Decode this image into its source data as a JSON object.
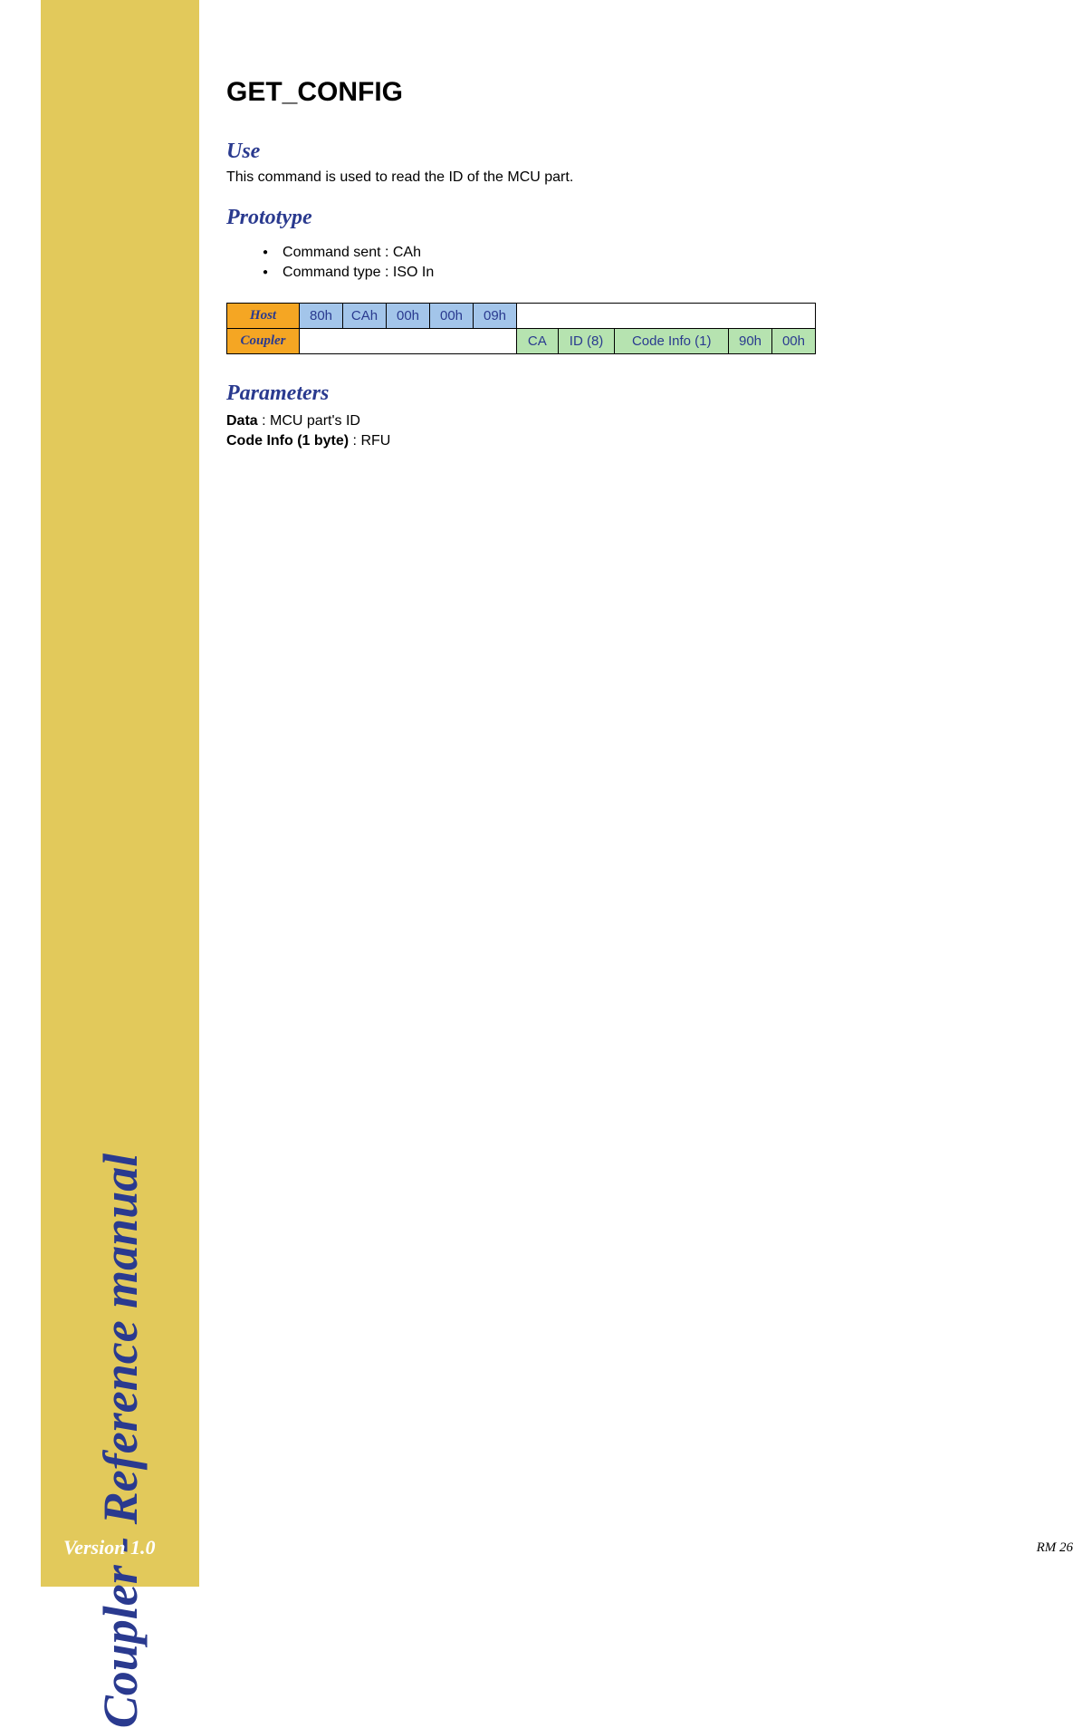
{
  "sidebar": {
    "title": "Coupler - Reference manual",
    "version": "Version 1.0"
  },
  "page": {
    "title": "GET_CONFIG",
    "footer": "RM 26"
  },
  "sections": {
    "use": {
      "heading": "Use",
      "text": "This command is used to read the ID of the MCU part."
    },
    "prototype": {
      "heading": "Prototype",
      "bullets": [
        "Command sent : CAh",
        "Command type : ISO In"
      ]
    },
    "parameters": {
      "heading": "Parameters",
      "data_label": "Data",
      "data_value": " : MCU part's ID",
      "code_label": "Code Info (1 byte)",
      "code_value": " : RFU"
    }
  },
  "table": {
    "host_label": "Host",
    "host_cells": [
      "80h",
      "CAh",
      "00h",
      "00h",
      "09h"
    ],
    "coupler_label": "Coupler",
    "coupler_cells": [
      "CA",
      "ID (8)",
      "Code Info (1)",
      "90h",
      "00h"
    ]
  }
}
